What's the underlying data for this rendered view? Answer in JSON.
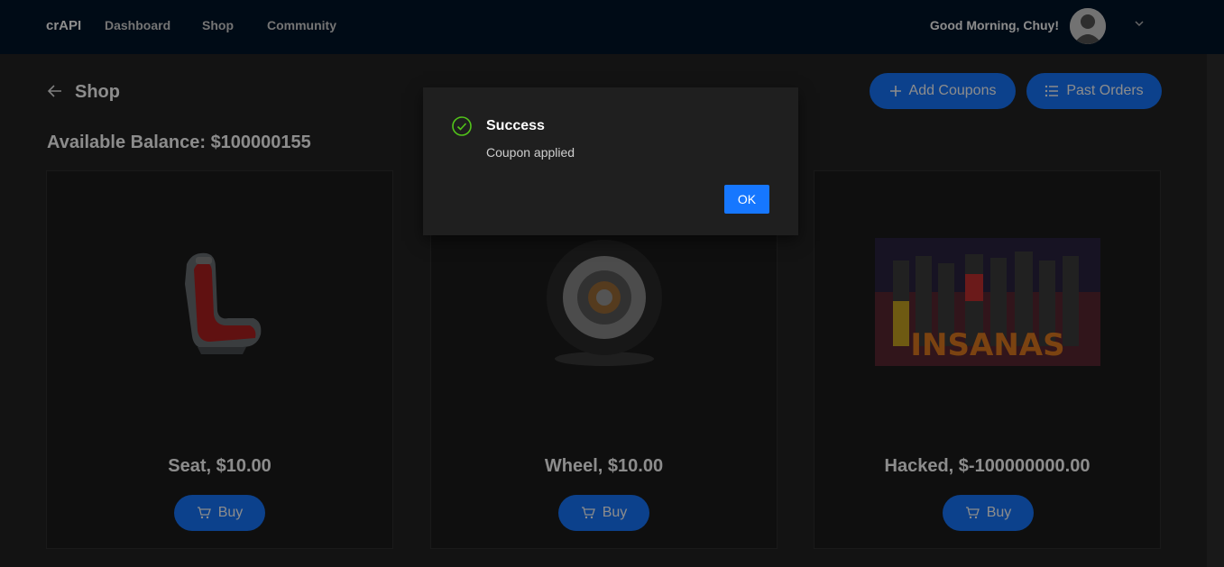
{
  "navbar": {
    "brand": "crAPI",
    "items": [
      {
        "label": "Dashboard"
      },
      {
        "label": "Shop"
      },
      {
        "label": "Community"
      }
    ],
    "greeting": "Good Morning, Chuy!"
  },
  "page": {
    "title": "Shop",
    "balance_label": "Available Balance: ",
    "balance_value": "$100000155",
    "add_coupons_label": "Add Coupons",
    "past_orders_label": "Past Orders"
  },
  "products": [
    {
      "label": "Seat, $10.00",
      "buy_label": "Buy"
    },
    {
      "label": "Wheel, $10.00",
      "buy_label": "Buy"
    },
    {
      "label": "Hacked, $-100000000.00",
      "buy_label": "Buy",
      "image_text": "INSANAS"
    }
  ],
  "modal": {
    "title": "Success",
    "message": "Coupon applied",
    "ok_label": "OK"
  },
  "colors": {
    "primary": "#1677ff",
    "navbar": "#001529",
    "success": "#52c41a"
  }
}
